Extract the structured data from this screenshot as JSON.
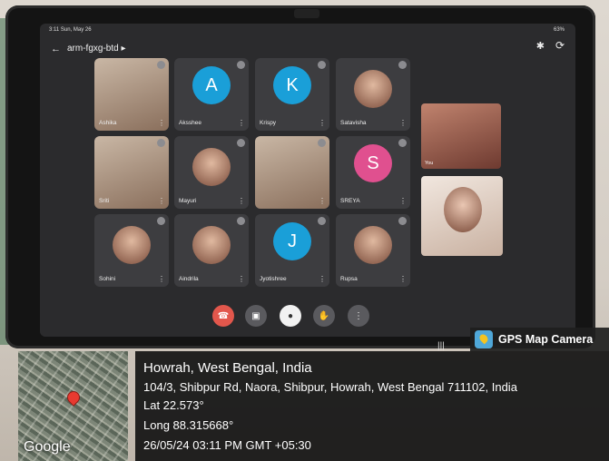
{
  "status_bar": {
    "time_date": "3:11 Sun, May 26",
    "right": "63%"
  },
  "meeting": {
    "code": "arm-fgxg-btd",
    "code_arrow": "▸"
  },
  "participants": [
    {
      "name": "Ashika",
      "kind": "photo"
    },
    {
      "name": "Aksshee",
      "kind": "avatar",
      "letter": "A",
      "color": "#1a9fd8"
    },
    {
      "name": "Krispy",
      "kind": "avatar",
      "letter": "K",
      "color": "#1a9fd8"
    },
    {
      "name": "Satavisha",
      "kind": "pic"
    },
    {
      "name": "Sriti",
      "kind": "photo"
    },
    {
      "name": "Mayuri",
      "kind": "pic"
    },
    {
      "name": "",
      "kind": "photo"
    },
    {
      "name": "SREYA",
      "kind": "avatar",
      "letter": "S",
      "color": "#e0508f"
    },
    {
      "name": "Sohini",
      "kind": "pic"
    },
    {
      "name": "Aindrila",
      "kind": "pic"
    },
    {
      "name": "Jyotishree",
      "kind": "avatar",
      "letter": "J",
      "color": "#1a9fd8"
    },
    {
      "name": "Rupsa",
      "kind": "pic"
    }
  ],
  "self_view": {
    "label": "You"
  },
  "controls": {
    "end_call_color": "#e2574c",
    "icons": [
      "end-call-icon",
      "camera-icon",
      "mic-icon",
      "raise-hand-icon",
      "more-options-icon"
    ]
  },
  "dock_apps": [
    "#5fa8e8",
    "#f3d36b",
    "#36c1d6",
    "#7ec8e3",
    "#f2a37b",
    "#e05d8a"
  ],
  "gps": {
    "badge": "GPS Map Camera",
    "location": "Howrah, West Bengal, India",
    "address": "104/3, Shibpur Rd, Naora, Shibpur, Howrah, West Bengal 711102, India",
    "lat": "Lat 22.573°",
    "long": "Long 88.315668°",
    "datetime": "26/05/24 03:11 PM GMT +05:30",
    "map_brand": "Google"
  }
}
